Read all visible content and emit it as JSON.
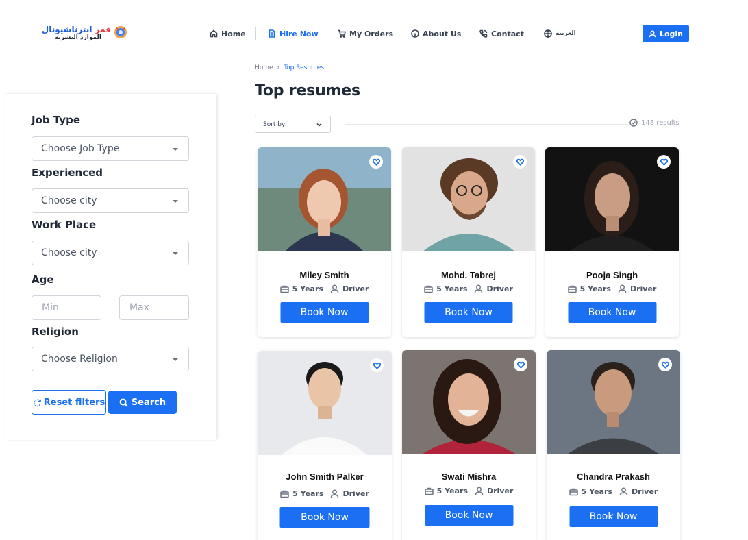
{
  "brand": {
    "logo_line1_blue": "انترناشيونال",
    "logo_line1_red": "قمر",
    "logo_line2": "الموارد البشرية"
  },
  "nav": {
    "items": [
      {
        "label": "Home",
        "icon": "home-icon"
      },
      {
        "label": "Hire Now",
        "icon": "document-icon",
        "active": true
      },
      {
        "label": "My Orders",
        "icon": "cart-icon"
      },
      {
        "label": "About Us",
        "icon": "info-icon"
      },
      {
        "label": "Contact",
        "icon": "phone-icon"
      },
      {
        "label": "العربية",
        "icon": "globe-icon"
      }
    ],
    "login_label": "Login"
  },
  "breadcrumb": {
    "home": "Home",
    "current": "Top Resumes"
  },
  "page_title": "Top resumes",
  "sort": {
    "label": "Sort by:"
  },
  "results_text": "148 results",
  "filters": {
    "job_type": {
      "label": "Job Type",
      "placeholder": "Choose Job Type"
    },
    "experienced": {
      "label": "Experienced",
      "placeholder": "Choose city"
    },
    "work_place": {
      "label": "Work Place",
      "placeholder": "Choose city"
    },
    "age": {
      "label": "Age",
      "min_placeholder": "Min",
      "max_placeholder": "Max"
    },
    "religion": {
      "label": "Religion",
      "placeholder": "Choose Religion"
    },
    "reset_label": "Reset filters",
    "search_label": "Search"
  },
  "cards": [
    {
      "name": "Miley Smith",
      "experience": "5 Years",
      "role": "Driver",
      "button": "Book Now"
    },
    {
      "name": "Mohd. Tabrej",
      "experience": "5 Years",
      "role": "Driver",
      "button": "Book Now"
    },
    {
      "name": "Pooja Singh",
      "experience": "5 Years",
      "role": "Driver",
      "button": "Book Now"
    },
    {
      "name": "John Smith Palker",
      "experience": "5 Years",
      "role": "Driver",
      "button": "Book Now"
    },
    {
      "name": "Swati Mishra",
      "experience": "5 Years",
      "role": "Driver",
      "button": "Book Now"
    },
    {
      "name": "Chandra Prakash",
      "experience": "5 Years",
      "role": "Driver",
      "button": "Book Now"
    }
  ],
  "colors": {
    "accent": "#1a6ff2",
    "text": "#1f2937",
    "muted": "#9ca3af"
  }
}
